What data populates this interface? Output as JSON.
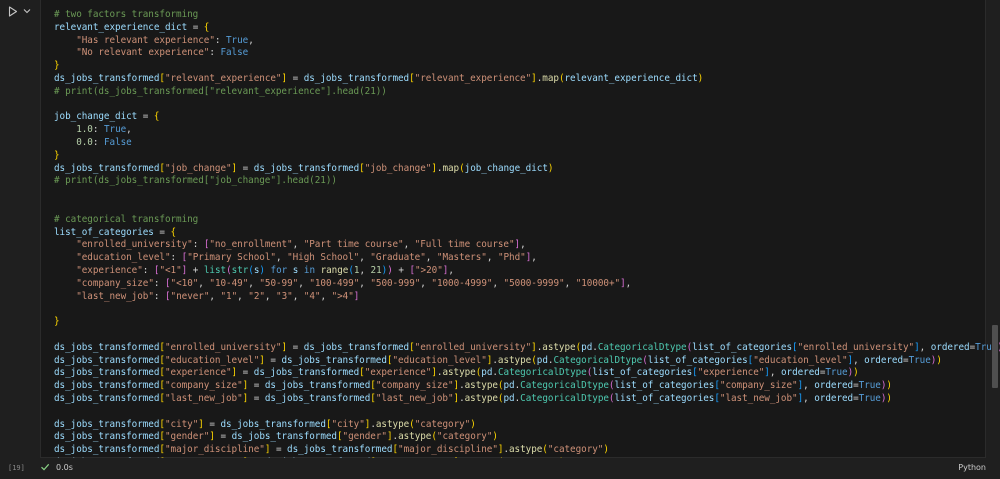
{
  "cell": {
    "execution_count": "[19]",
    "duration": "0.0s",
    "language": "Python",
    "status": "success"
  },
  "colors": {
    "background": "#181818",
    "comment": "#6a9955",
    "variable": "#9cdcfe",
    "string": "#ce9178",
    "keyword": "#569cd6",
    "number": "#b5cea8",
    "function": "#dcdcaa",
    "class": "#4ec9b0",
    "success_check": "#89d185"
  },
  "icons": [
    "run-icon",
    "chevron-down-icon",
    "check-icon"
  ],
  "code_lines": [
    [
      [
        "cm",
        "# two factors transforming"
      ]
    ],
    [
      [
        "v",
        "relevant_experience_dict"
      ],
      [
        "p",
        " = "
      ],
      [
        "b1",
        "{"
      ]
    ],
    [
      [
        "p",
        "    "
      ],
      [
        "s",
        "\"Has relevant experience\""
      ],
      [
        "p",
        ": "
      ],
      [
        "k",
        "True"
      ],
      [
        "p",
        ","
      ]
    ],
    [
      [
        "p",
        "    "
      ],
      [
        "s",
        "\"No relevant experience\""
      ],
      [
        "p",
        ": "
      ],
      [
        "k",
        "False"
      ]
    ],
    [
      [
        "b1",
        "}"
      ]
    ],
    [
      [
        "v",
        "ds_jobs_transformed"
      ],
      [
        "b1",
        "["
      ],
      [
        "s",
        "\"relevant_experience\""
      ],
      [
        "b1",
        "]"
      ],
      [
        "p",
        " = "
      ],
      [
        "v",
        "ds_jobs_transformed"
      ],
      [
        "b1",
        "["
      ],
      [
        "s",
        "\"relevant_experience\""
      ],
      [
        "b1",
        "]"
      ],
      [
        "p",
        "."
      ],
      [
        "f",
        "map"
      ],
      [
        "b1",
        "("
      ],
      [
        "v",
        "relevant_experience_dict"
      ],
      [
        "b1",
        ")"
      ]
    ],
    [
      [
        "cm",
        "# print(ds_jobs_transformed[\"relevant_experience\"].head(21))"
      ]
    ],
    [
      [
        "p",
        ""
      ]
    ],
    [
      [
        "v",
        "job_change_dict"
      ],
      [
        "p",
        " = "
      ],
      [
        "b1",
        "{"
      ]
    ],
    [
      [
        "p",
        "    "
      ],
      [
        "n",
        "1.0"
      ],
      [
        "p",
        ": "
      ],
      [
        "k",
        "True"
      ],
      [
        "p",
        ","
      ]
    ],
    [
      [
        "p",
        "    "
      ],
      [
        "n",
        "0.0"
      ],
      [
        "p",
        ": "
      ],
      [
        "k",
        "False"
      ]
    ],
    [
      [
        "b1",
        "}"
      ]
    ],
    [
      [
        "v",
        "ds_jobs_transformed"
      ],
      [
        "b1",
        "["
      ],
      [
        "s",
        "\"job_change\""
      ],
      [
        "b1",
        "]"
      ],
      [
        "p",
        " = "
      ],
      [
        "v",
        "ds_jobs_transformed"
      ],
      [
        "b1",
        "["
      ],
      [
        "s",
        "\"job_change\""
      ],
      [
        "b1",
        "]"
      ],
      [
        "p",
        "."
      ],
      [
        "f",
        "map"
      ],
      [
        "b1",
        "("
      ],
      [
        "v",
        "job_change_dict"
      ],
      [
        "b1",
        ")"
      ]
    ],
    [
      [
        "cm",
        "# print(ds_jobs_transformed[\"job_change\"].head(21))"
      ]
    ],
    [
      [
        "p",
        ""
      ]
    ],
    [
      [
        "p",
        ""
      ]
    ],
    [
      [
        "cm",
        "# categorical transforming"
      ]
    ],
    [
      [
        "v",
        "list_of_categories"
      ],
      [
        "p",
        " = "
      ],
      [
        "b1",
        "{"
      ]
    ],
    [
      [
        "p",
        "    "
      ],
      [
        "s",
        "\"enrolled_university\""
      ],
      [
        "p",
        ": "
      ],
      [
        "b2",
        "["
      ],
      [
        "s",
        "\"no_enrollment\""
      ],
      [
        "p",
        ", "
      ],
      [
        "s",
        "\"Part time course\""
      ],
      [
        "p",
        ", "
      ],
      [
        "s",
        "\"Full time course\""
      ],
      [
        "b2",
        "]"
      ],
      [
        "p",
        ","
      ]
    ],
    [
      [
        "p",
        "    "
      ],
      [
        "s",
        "\"education_level\""
      ],
      [
        "p",
        ": "
      ],
      [
        "b2",
        "["
      ],
      [
        "s",
        "\"Primary School\""
      ],
      [
        "p",
        ", "
      ],
      [
        "s",
        "\"High School\""
      ],
      [
        "p",
        ", "
      ],
      [
        "s",
        "\"Graduate\""
      ],
      [
        "p",
        ", "
      ],
      [
        "s",
        "\"Masters\""
      ],
      [
        "p",
        ", "
      ],
      [
        "s",
        "\"Phd\""
      ],
      [
        "b2",
        "]"
      ],
      [
        "p",
        ","
      ]
    ],
    [
      [
        "p",
        "    "
      ],
      [
        "s",
        "\"experience\""
      ],
      [
        "p",
        ": "
      ],
      [
        "b2",
        "["
      ],
      [
        "s",
        "\"<1\""
      ],
      [
        "b2",
        "]"
      ],
      [
        "p",
        " + "
      ],
      [
        "c",
        "list"
      ],
      [
        "b2",
        "("
      ],
      [
        "c",
        "str"
      ],
      [
        "b3",
        "("
      ],
      [
        "v",
        "s"
      ],
      [
        "b3",
        ")"
      ],
      [
        "p",
        " "
      ],
      [
        "k",
        "for"
      ],
      [
        "p",
        " "
      ],
      [
        "v",
        "s"
      ],
      [
        "p",
        " "
      ],
      [
        "k",
        "in"
      ],
      [
        "p",
        " "
      ],
      [
        "f",
        "range"
      ],
      [
        "b3",
        "("
      ],
      [
        "n",
        "1"
      ],
      [
        "p",
        ", "
      ],
      [
        "n",
        "21"
      ],
      [
        "b3",
        ")"
      ],
      [
        "b2",
        ")"
      ],
      [
        "p",
        " + "
      ],
      [
        "b2",
        "["
      ],
      [
        "s",
        "\">20\""
      ],
      [
        "b2",
        "]"
      ],
      [
        "p",
        ","
      ]
    ],
    [
      [
        "p",
        "    "
      ],
      [
        "s",
        "\"company_size\""
      ],
      [
        "p",
        ": "
      ],
      [
        "b2",
        "["
      ],
      [
        "s",
        "\"<10\""
      ],
      [
        "p",
        ", "
      ],
      [
        "s",
        "\"10-49\""
      ],
      [
        "p",
        ", "
      ],
      [
        "s",
        "\"50-99\""
      ],
      [
        "p",
        ", "
      ],
      [
        "s",
        "\"100-499\""
      ],
      [
        "p",
        ", "
      ],
      [
        "s",
        "\"500-999\""
      ],
      [
        "p",
        ", "
      ],
      [
        "s",
        "\"1000-4999\""
      ],
      [
        "p",
        ", "
      ],
      [
        "s",
        "\"5000-9999\""
      ],
      [
        "p",
        ", "
      ],
      [
        "s",
        "\"10000+\""
      ],
      [
        "b2",
        "]"
      ],
      [
        "p",
        ","
      ]
    ],
    [
      [
        "p",
        "    "
      ],
      [
        "s",
        "\"last_new_job\""
      ],
      [
        "p",
        ": "
      ],
      [
        "b2",
        "["
      ],
      [
        "s",
        "\"never\""
      ],
      [
        "p",
        ", "
      ],
      [
        "s",
        "\"1\""
      ],
      [
        "p",
        ", "
      ],
      [
        "s",
        "\"2\""
      ],
      [
        "p",
        ", "
      ],
      [
        "s",
        "\"3\""
      ],
      [
        "p",
        ", "
      ],
      [
        "s",
        "\"4\""
      ],
      [
        "p",
        ", "
      ],
      [
        "s",
        "\">4\""
      ],
      [
        "b2",
        "]"
      ]
    ],
    [
      [
        "p",
        ""
      ]
    ],
    [
      [
        "b1",
        "}"
      ]
    ],
    [
      [
        "p",
        ""
      ]
    ],
    [
      [
        "v",
        "ds_jobs_transformed"
      ],
      [
        "b1",
        "["
      ],
      [
        "s",
        "\"enrolled_university\""
      ],
      [
        "b1",
        "]"
      ],
      [
        "p",
        " = "
      ],
      [
        "v",
        "ds_jobs_transformed"
      ],
      [
        "b1",
        "["
      ],
      [
        "s",
        "\"enrolled_university\""
      ],
      [
        "b1",
        "]"
      ],
      [
        "p",
        "."
      ],
      [
        "f",
        "astype"
      ],
      [
        "b1",
        "("
      ],
      [
        "v",
        "pd"
      ],
      [
        "p",
        "."
      ],
      [
        "c",
        "CategoricalDtype"
      ],
      [
        "b2",
        "("
      ],
      [
        "v",
        "list_of_categories"
      ],
      [
        "b3",
        "["
      ],
      [
        "s",
        "\"enrolled_university\""
      ],
      [
        "b3",
        "]"
      ],
      [
        "p",
        ", "
      ],
      [
        "v",
        "ordered"
      ],
      [
        "p",
        "="
      ],
      [
        "k",
        "True"
      ],
      [
        "b2",
        ")"
      ],
      [
        "b1",
        ")"
      ]
    ],
    [
      [
        "v",
        "ds_jobs_transformed"
      ],
      [
        "b1",
        "["
      ],
      [
        "s",
        "\"education_level\""
      ],
      [
        "b1",
        "]"
      ],
      [
        "p",
        " = "
      ],
      [
        "v",
        "ds_jobs_transformed"
      ],
      [
        "b1",
        "["
      ],
      [
        "s",
        "\"education_level\""
      ],
      [
        "b1",
        "]"
      ],
      [
        "p",
        "."
      ],
      [
        "f",
        "astype"
      ],
      [
        "b1",
        "("
      ],
      [
        "v",
        "pd"
      ],
      [
        "p",
        "."
      ],
      [
        "c",
        "CategoricalDtype"
      ],
      [
        "b2",
        "("
      ],
      [
        "v",
        "list_of_categories"
      ],
      [
        "b3",
        "["
      ],
      [
        "s",
        "\"education_level\""
      ],
      [
        "b3",
        "]"
      ],
      [
        "p",
        ", "
      ],
      [
        "v",
        "ordered"
      ],
      [
        "p",
        "="
      ],
      [
        "k",
        "True"
      ],
      [
        "b2",
        ")"
      ],
      [
        "b1",
        ")"
      ]
    ],
    [
      [
        "v",
        "ds_jobs_transformed"
      ],
      [
        "b1",
        "["
      ],
      [
        "s",
        "\"experience\""
      ],
      [
        "b1",
        "]"
      ],
      [
        "p",
        " = "
      ],
      [
        "v",
        "ds_jobs_transformed"
      ],
      [
        "b1",
        "["
      ],
      [
        "s",
        "\"experience\""
      ],
      [
        "b1",
        "]"
      ],
      [
        "p",
        "."
      ],
      [
        "f",
        "astype"
      ],
      [
        "b1",
        "("
      ],
      [
        "v",
        "pd"
      ],
      [
        "p",
        "."
      ],
      [
        "c",
        "CategoricalDtype"
      ],
      [
        "b2",
        "("
      ],
      [
        "v",
        "list_of_categories"
      ],
      [
        "b3",
        "["
      ],
      [
        "s",
        "\"experience\""
      ],
      [
        "b3",
        "]"
      ],
      [
        "p",
        ", "
      ],
      [
        "v",
        "ordered"
      ],
      [
        "p",
        "="
      ],
      [
        "k",
        "True"
      ],
      [
        "b2",
        ")"
      ],
      [
        "b1",
        ")"
      ]
    ],
    [
      [
        "v",
        "ds_jobs_transformed"
      ],
      [
        "b1",
        "["
      ],
      [
        "s",
        "\"company_size\""
      ],
      [
        "b1",
        "]"
      ],
      [
        "p",
        " = "
      ],
      [
        "v",
        "ds_jobs_transformed"
      ],
      [
        "b1",
        "["
      ],
      [
        "s",
        "\"company_size\""
      ],
      [
        "b1",
        "]"
      ],
      [
        "p",
        "."
      ],
      [
        "f",
        "astype"
      ],
      [
        "b1",
        "("
      ],
      [
        "v",
        "pd"
      ],
      [
        "p",
        "."
      ],
      [
        "c",
        "CategoricalDtype"
      ],
      [
        "b2",
        "("
      ],
      [
        "v",
        "list_of_categories"
      ],
      [
        "b3",
        "["
      ],
      [
        "s",
        "\"company_size\""
      ],
      [
        "b3",
        "]"
      ],
      [
        "p",
        ", "
      ],
      [
        "v",
        "ordered"
      ],
      [
        "p",
        "="
      ],
      [
        "k",
        "True"
      ],
      [
        "b2",
        ")"
      ],
      [
        "b1",
        ")"
      ]
    ],
    [
      [
        "v",
        "ds_jobs_transformed"
      ],
      [
        "b1",
        "["
      ],
      [
        "s",
        "\"last_new_job\""
      ],
      [
        "b1",
        "]"
      ],
      [
        "p",
        " = "
      ],
      [
        "v",
        "ds_jobs_transformed"
      ],
      [
        "b1",
        "["
      ],
      [
        "s",
        "\"last_new_job\""
      ],
      [
        "b1",
        "]"
      ],
      [
        "p",
        "."
      ],
      [
        "f",
        "astype"
      ],
      [
        "b1",
        "("
      ],
      [
        "v",
        "pd"
      ],
      [
        "p",
        "."
      ],
      [
        "c",
        "CategoricalDtype"
      ],
      [
        "b2",
        "("
      ],
      [
        "v",
        "list_of_categories"
      ],
      [
        "b3",
        "["
      ],
      [
        "s",
        "\"last_new_job\""
      ],
      [
        "b3",
        "]"
      ],
      [
        "p",
        ", "
      ],
      [
        "v",
        "ordered"
      ],
      [
        "p",
        "="
      ],
      [
        "k",
        "True"
      ],
      [
        "b2",
        ")"
      ],
      [
        "b1",
        ")"
      ]
    ],
    [
      [
        "p",
        ""
      ]
    ],
    [
      [
        "v",
        "ds_jobs_transformed"
      ],
      [
        "b1",
        "["
      ],
      [
        "s",
        "\"city\""
      ],
      [
        "b1",
        "]"
      ],
      [
        "p",
        " = "
      ],
      [
        "v",
        "ds_jobs_transformed"
      ],
      [
        "b1",
        "["
      ],
      [
        "s",
        "\"city\""
      ],
      [
        "b1",
        "]"
      ],
      [
        "p",
        "."
      ],
      [
        "f",
        "astype"
      ],
      [
        "b1",
        "("
      ],
      [
        "s",
        "\"category\""
      ],
      [
        "b1",
        ")"
      ]
    ],
    [
      [
        "v",
        "ds_jobs_transformed"
      ],
      [
        "b1",
        "["
      ],
      [
        "s",
        "\"gender\""
      ],
      [
        "b1",
        "]"
      ],
      [
        "p",
        " = "
      ],
      [
        "v",
        "ds_jobs_transformed"
      ],
      [
        "b1",
        "["
      ],
      [
        "s",
        "\"gender\""
      ],
      [
        "b1",
        "]"
      ],
      [
        "p",
        "."
      ],
      [
        "f",
        "astype"
      ],
      [
        "b1",
        "("
      ],
      [
        "s",
        "\"category\""
      ],
      [
        "b1",
        ")"
      ]
    ],
    [
      [
        "v",
        "ds_jobs_transformed"
      ],
      [
        "b1",
        "["
      ],
      [
        "s",
        "\"major_discipline\""
      ],
      [
        "b1",
        "]"
      ],
      [
        "p",
        " = "
      ],
      [
        "v",
        "ds_jobs_transformed"
      ],
      [
        "b1",
        "["
      ],
      [
        "s",
        "\"major_discipline\""
      ],
      [
        "b1",
        "]"
      ],
      [
        "p",
        "."
      ],
      [
        "f",
        "astype"
      ],
      [
        "b1",
        "("
      ],
      [
        "s",
        "\"category\""
      ],
      [
        "b1",
        ")"
      ]
    ],
    [
      [
        "v",
        "ds_jobs_transformed"
      ],
      [
        "b1",
        "["
      ],
      [
        "s",
        "\"company_type\""
      ],
      [
        "b1",
        "]"
      ],
      [
        "p",
        " = "
      ],
      [
        "v",
        "ds_jobs_transformed"
      ],
      [
        "b1",
        "["
      ],
      [
        "s",
        "\"company_type\""
      ],
      [
        "b1",
        "]"
      ],
      [
        "p",
        "."
      ],
      [
        "f",
        "astype"
      ],
      [
        "b1",
        "("
      ],
      [
        "s",
        "\"category\""
      ],
      [
        "b1",
        ")"
      ]
    ]
  ]
}
